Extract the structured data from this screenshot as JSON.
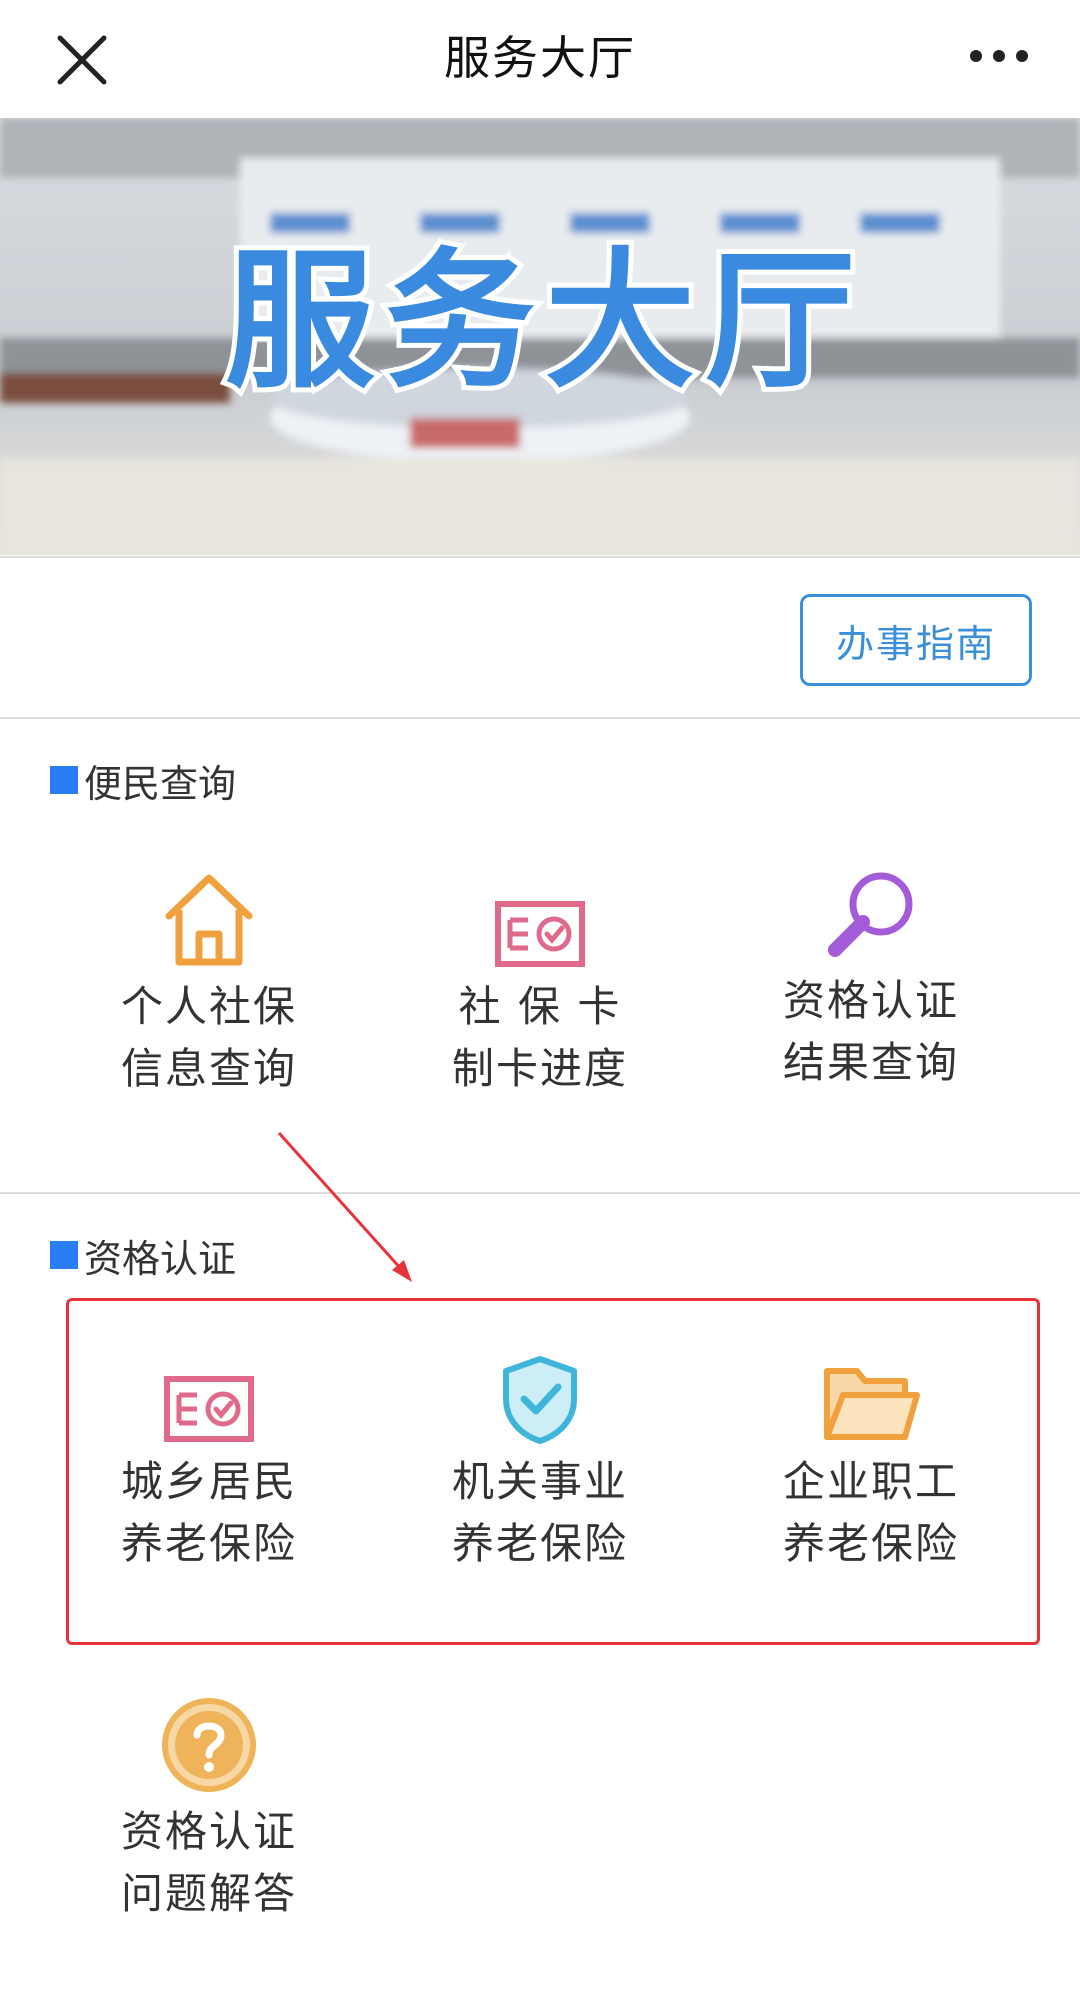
{
  "header": {
    "title": "服务大厅",
    "close_icon": "close-icon",
    "more_icon": "more-dots-icon"
  },
  "banner": {
    "text": "服务大厅",
    "text_color": "#3a8be0"
  },
  "guide_button": {
    "label": "办事指南",
    "color": "#3b8fd8"
  },
  "sections": [
    {
      "title": "便民查询",
      "items": [
        {
          "line1": "个人社保",
          "line2": "信息查询",
          "icon": "house-icon",
          "color": "#f0a03c"
        },
        {
          "line1": "社 保 卡",
          "line2": "制卡进度",
          "icon": "certificate-icon",
          "color": "#e06a8c"
        },
        {
          "line1": "资格认证",
          "line2": "结果查询",
          "icon": "magnifier-icon",
          "color": "#a45bd8"
        }
      ]
    },
    {
      "title": "资格认证",
      "items": [
        {
          "line1": "城乡居民",
          "line2": "养老保险",
          "icon": "certificate-icon",
          "color": "#e06a8c"
        },
        {
          "line1": "机关事业",
          "line2": "养老保险",
          "icon": "shield-check-icon",
          "color": "#3fb6d9"
        },
        {
          "line1": "企业职工",
          "line2": "养老保险",
          "icon": "folder-icon",
          "color": "#f0a03c"
        },
        {
          "line1": "资格认证",
          "line2": "问题解答",
          "icon": "question-circle-icon",
          "color": "#efb35a"
        }
      ]
    }
  ],
  "annotation": {
    "box_color": "#e8333b",
    "arrow_color": "#e8333b"
  }
}
